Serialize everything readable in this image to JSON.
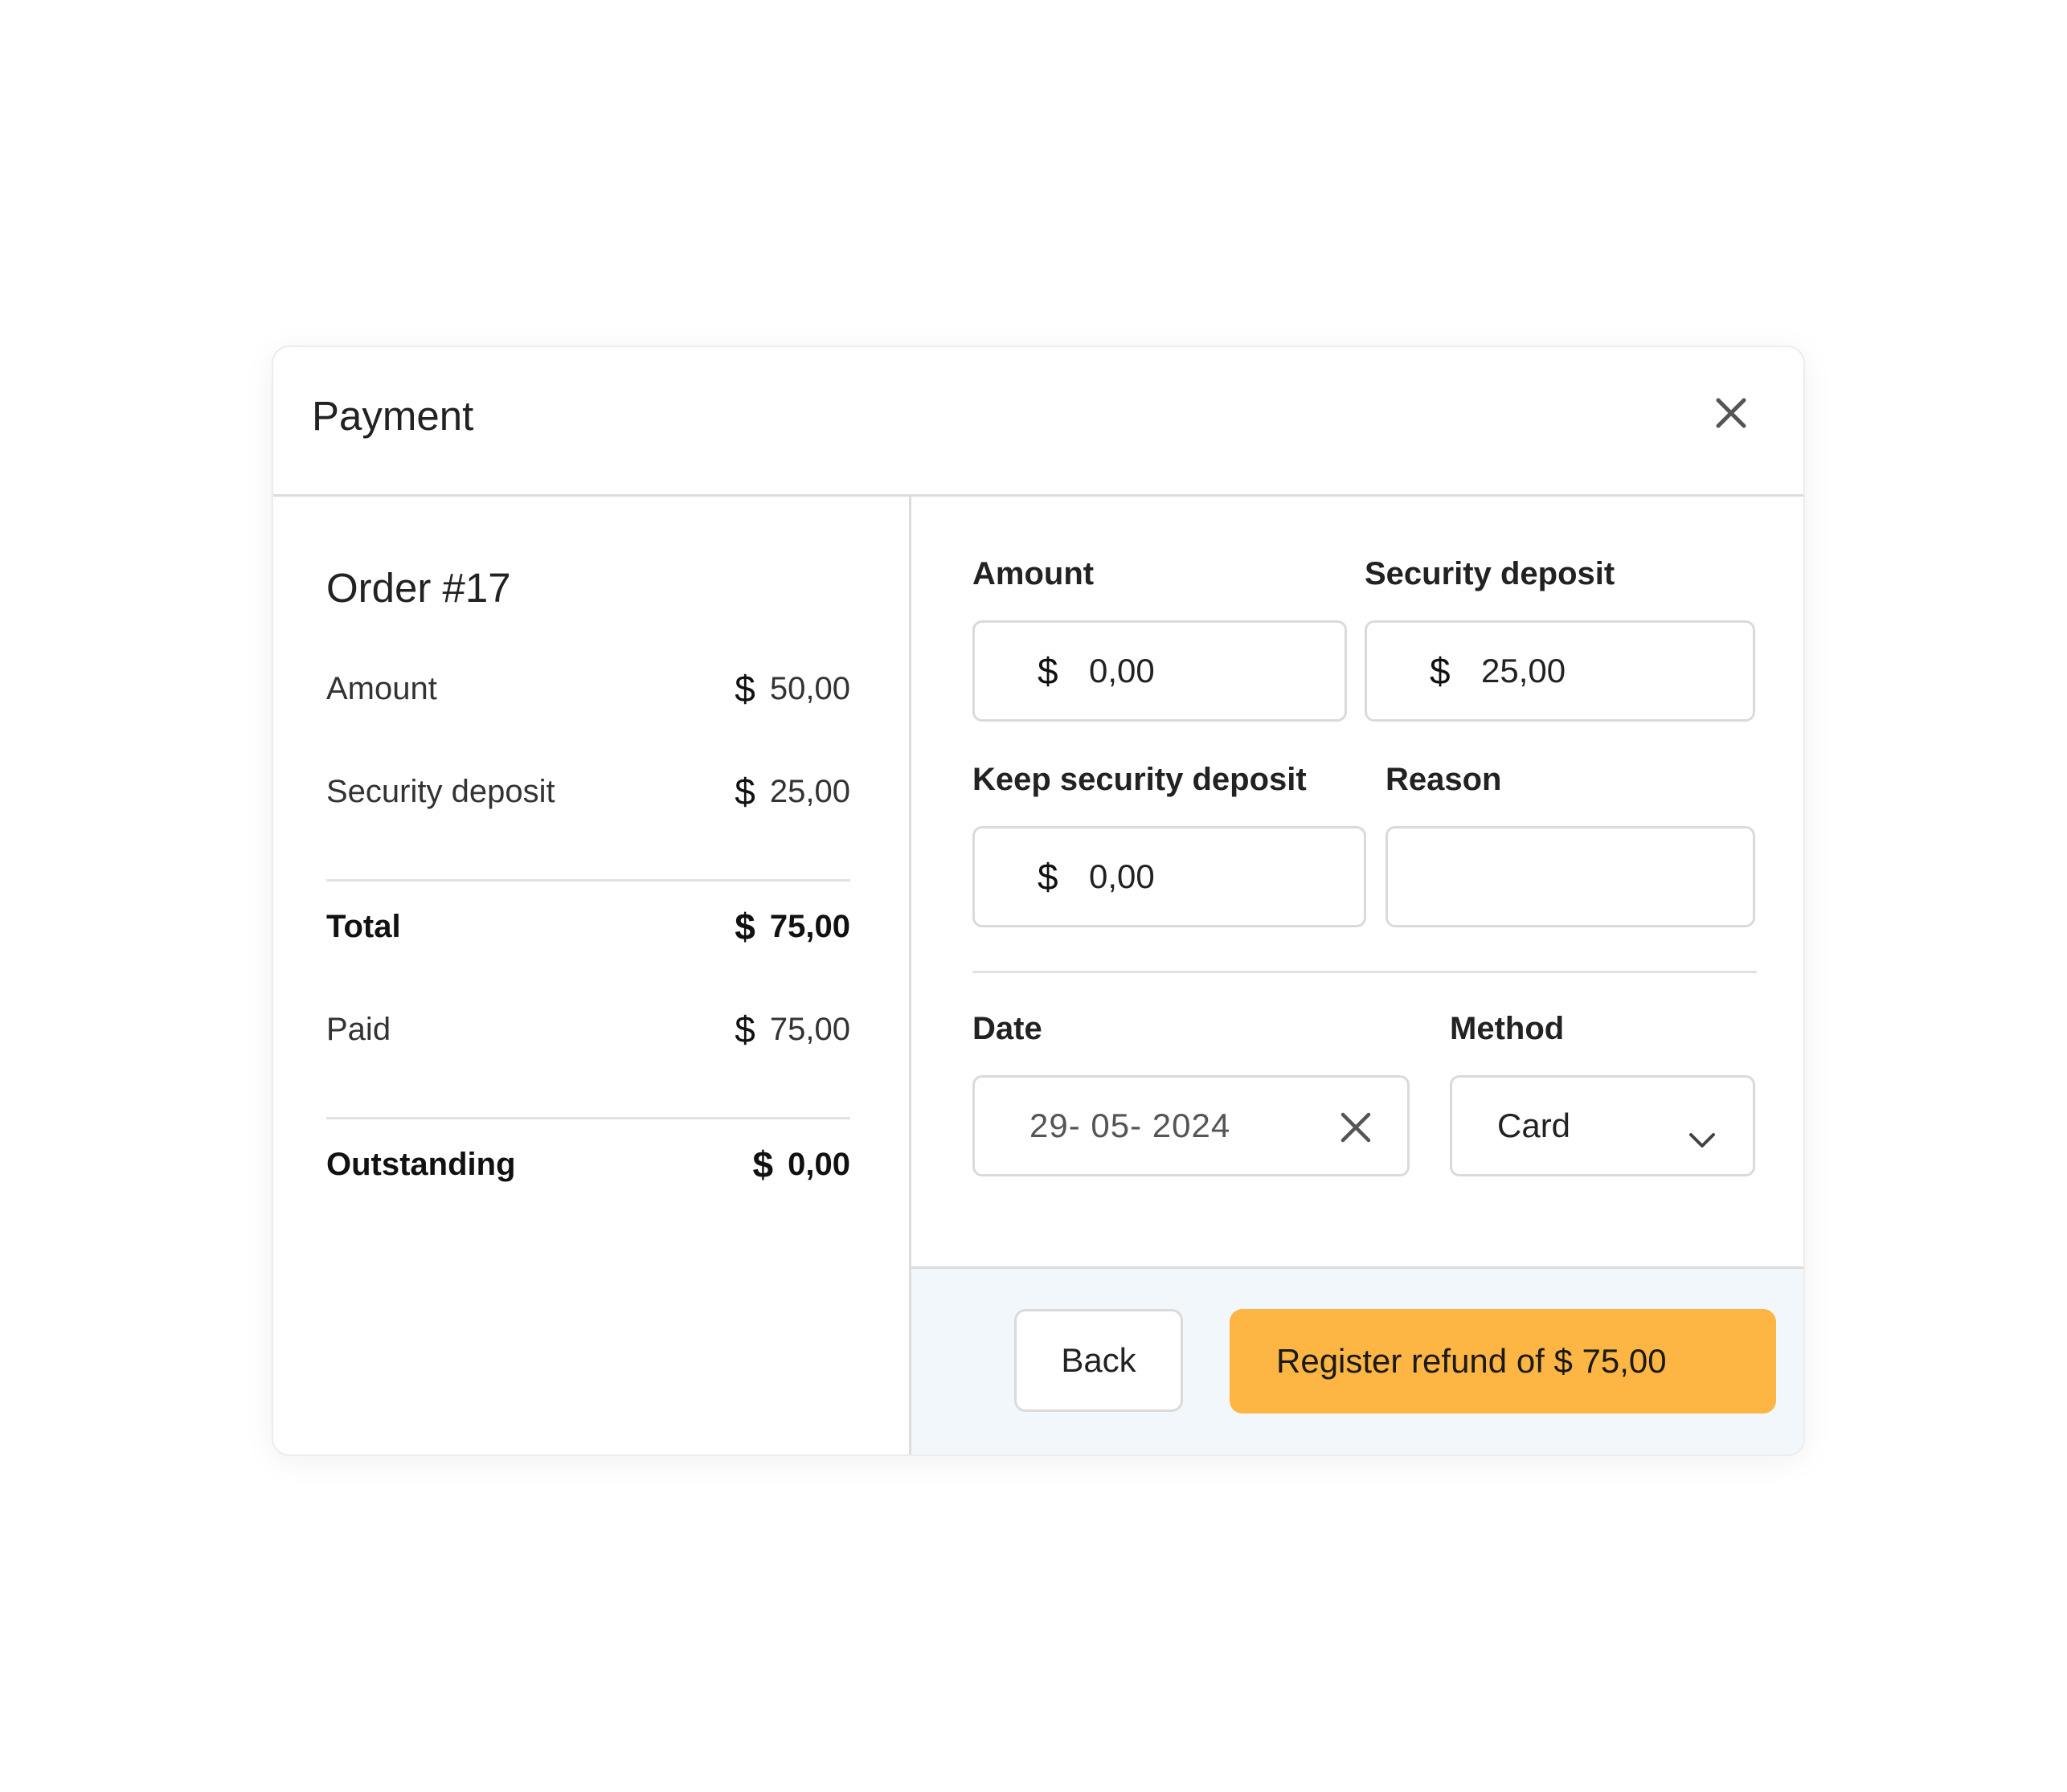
{
  "modal": {
    "title": "Payment",
    "close_icon": "close-icon"
  },
  "summary": {
    "order_title": "Order #17",
    "currency_symbol": "$",
    "rows": [
      {
        "label": "Amount",
        "value": "50,00"
      },
      {
        "label": "Security deposit",
        "value": "25,00"
      },
      {
        "label": "Total",
        "value": "75,00"
      },
      {
        "label": "Paid",
        "value": "75,00"
      },
      {
        "label": "Outstanding",
        "value": "0,00"
      }
    ]
  },
  "form": {
    "amount": {
      "label": "Amount",
      "currency": "$",
      "value": "0,00"
    },
    "security_deposit": {
      "label": "Security deposit",
      "currency": "$",
      "value": "25,00"
    },
    "keep_security_deposit": {
      "label": "Keep security deposit",
      "currency": "$",
      "value": "0,00"
    },
    "reason": {
      "label": "Reason",
      "value": ""
    },
    "date": {
      "label": "Date",
      "value": "29- 05- 2024"
    },
    "method": {
      "label": "Method",
      "value": "Card"
    }
  },
  "footer": {
    "back_label": "Back",
    "submit_label": "Register refund of $ 75,00"
  },
  "colors": {
    "primary_button": "#fdb544",
    "footer_background": "#f2f7fb"
  }
}
